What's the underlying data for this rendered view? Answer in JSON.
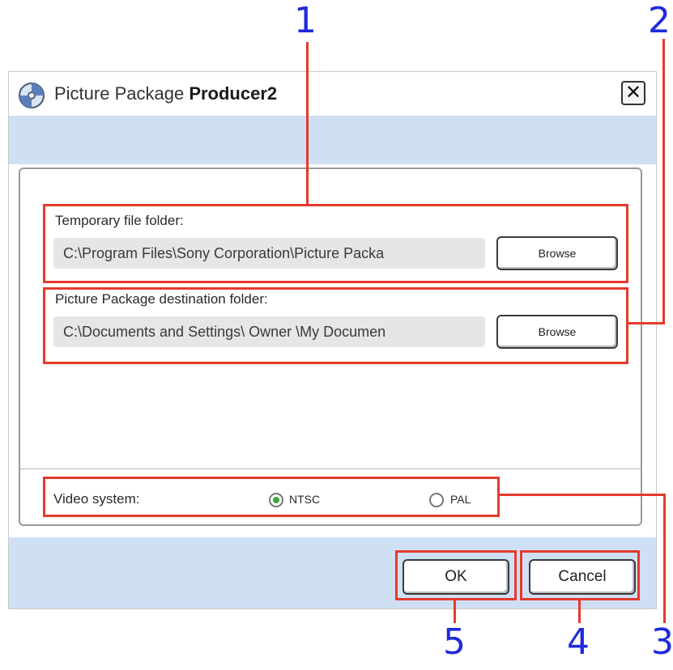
{
  "window": {
    "title_prefix": "Picture Package ",
    "title_bold": "Producer2",
    "close_glyph": "✕",
    "icon": "picture-package-icon"
  },
  "temp_folder": {
    "label": "Temporary file folder:",
    "path": "C:\\Program Files\\Sony Corporation\\Picture Packa",
    "browse_label": "Browse"
  },
  "dest_folder": {
    "label": "Picture Package destination folder:",
    "path": "C:\\Documents and Settings\\ Owner \\My Documen",
    "browse_label": "Browse"
  },
  "video_system": {
    "label": "Video system:",
    "options": [
      {
        "label": "NTSC",
        "selected": true
      },
      {
        "label": "PAL",
        "selected": false
      }
    ]
  },
  "buttons": {
    "ok": "OK",
    "cancel": "Cancel"
  },
  "callouts": [
    "1",
    "2",
    "3",
    "4",
    "5"
  ],
  "colors": {
    "callout_number": "#1f2bdc",
    "callout_line": "#e53a2c",
    "band": "#cfe0f4",
    "radio_selected": "#3aa53a"
  }
}
